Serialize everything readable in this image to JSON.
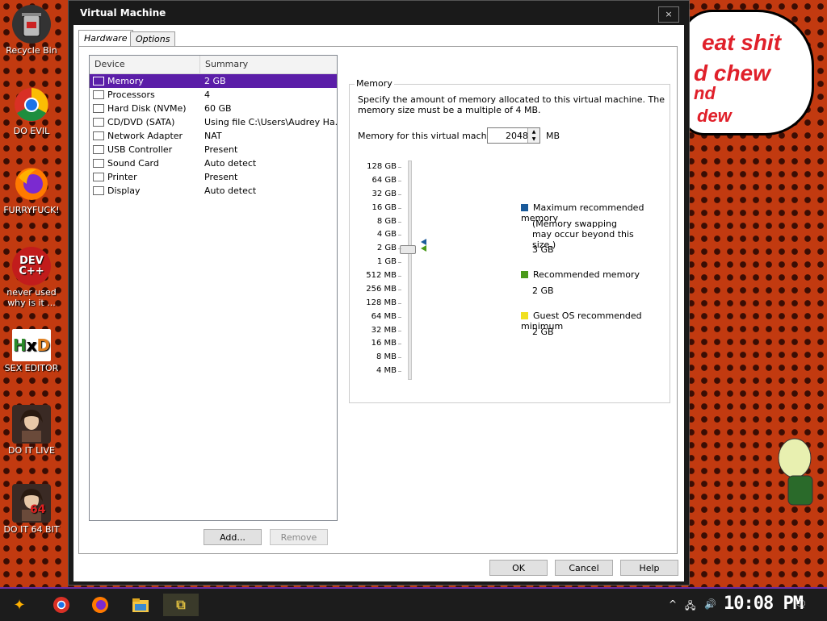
{
  "desktop": {
    "icons": [
      {
        "label": "Recycle Bin",
        "icon": "recycle-bin-icon"
      },
      {
        "label": "DO EVIL",
        "icon": "chrome-icon"
      },
      {
        "label": "FURRYFUCK!",
        "icon": "firefox-icon"
      },
      {
        "label": "never used why is it ...",
        "icon": "devcpp-icon",
        "badge": "DEV C++"
      },
      {
        "label": "SEX EDITOR",
        "icon": "hxd-icon",
        "badge": "HxD"
      },
      {
        "label": "DO IT LIVE",
        "icon": "portrait-icon"
      },
      {
        "label": "DO IT 64 BIT",
        "icon": "portrait-icon",
        "badge": "64"
      }
    ],
    "bubble_lines": [
      "eat shit",
      "d chew",
      "nd",
      "dew"
    ]
  },
  "dialog": {
    "title": "Virtual Machine",
    "close_label": "×",
    "tabs": [
      {
        "label": "Hardware",
        "active": true
      },
      {
        "label": "Options",
        "active": false
      }
    ],
    "device_columns": [
      "Device",
      "Summary"
    ],
    "devices": [
      {
        "name": "Memory",
        "summary": "2 GB",
        "icon": "memory-icon",
        "selected": true
      },
      {
        "name": "Processors",
        "summary": "4",
        "icon": "processor-icon"
      },
      {
        "name": "Hard Disk (NVMe)",
        "summary": "60 GB",
        "icon": "hard-disk-icon"
      },
      {
        "name": "CD/DVD (SATA)",
        "summary": "Using file C:\\Users\\Audrey Ha...",
        "icon": "cd-dvd-icon"
      },
      {
        "name": "Network Adapter",
        "summary": "NAT",
        "icon": "network-icon"
      },
      {
        "name": "USB Controller",
        "summary": "Present",
        "icon": "usb-icon"
      },
      {
        "name": "Sound Card",
        "summary": "Auto detect",
        "icon": "speaker-icon"
      },
      {
        "name": "Printer",
        "summary": "Present",
        "icon": "printer-icon"
      },
      {
        "name": "Display",
        "summary": "Auto detect",
        "icon": "display-icon"
      }
    ],
    "add_label": "Add...",
    "remove_label": "Remove",
    "memory": {
      "group_title": "Memory",
      "description": "Specify the amount of memory allocated to this virtual machine. The memory size must be a multiple of 4 MB.",
      "field_label": "Memory for this virtual machine:",
      "value": "2048",
      "unit": "MB",
      "scale_labels": [
        "128 GB",
        "64 GB",
        "32 GB",
        "16 GB",
        "8 GB",
        "4 GB",
        "2 GB",
        "1 GB",
        "512 MB",
        "256 MB",
        "128 MB",
        "64 MB",
        "32 MB",
        "16 MB",
        "8 MB",
        "4 MB"
      ],
      "slider_value": "2 GB",
      "legend": {
        "max_label": "Maximum recommended memory",
        "max_note": "(Memory swapping may occur beyond this size.)",
        "max_value": "3 GB",
        "max_color": "#1a5a9a",
        "rec_label": "Recommended memory",
        "rec_value": "2 GB",
        "rec_color": "#4a9a1a",
        "guest_label": "Guest OS recommended minimum",
        "guest_value": "2 GB",
        "guest_color": "#f0e020"
      }
    },
    "buttons": {
      "ok": "OK",
      "cancel": "Cancel",
      "help": "Help"
    }
  },
  "taskbar": {
    "clock": "10:08 PM",
    "items": [
      "start-icon",
      "chrome-icon",
      "firefox-icon",
      "file-explorer-icon",
      "vmware-icon"
    ]
  }
}
